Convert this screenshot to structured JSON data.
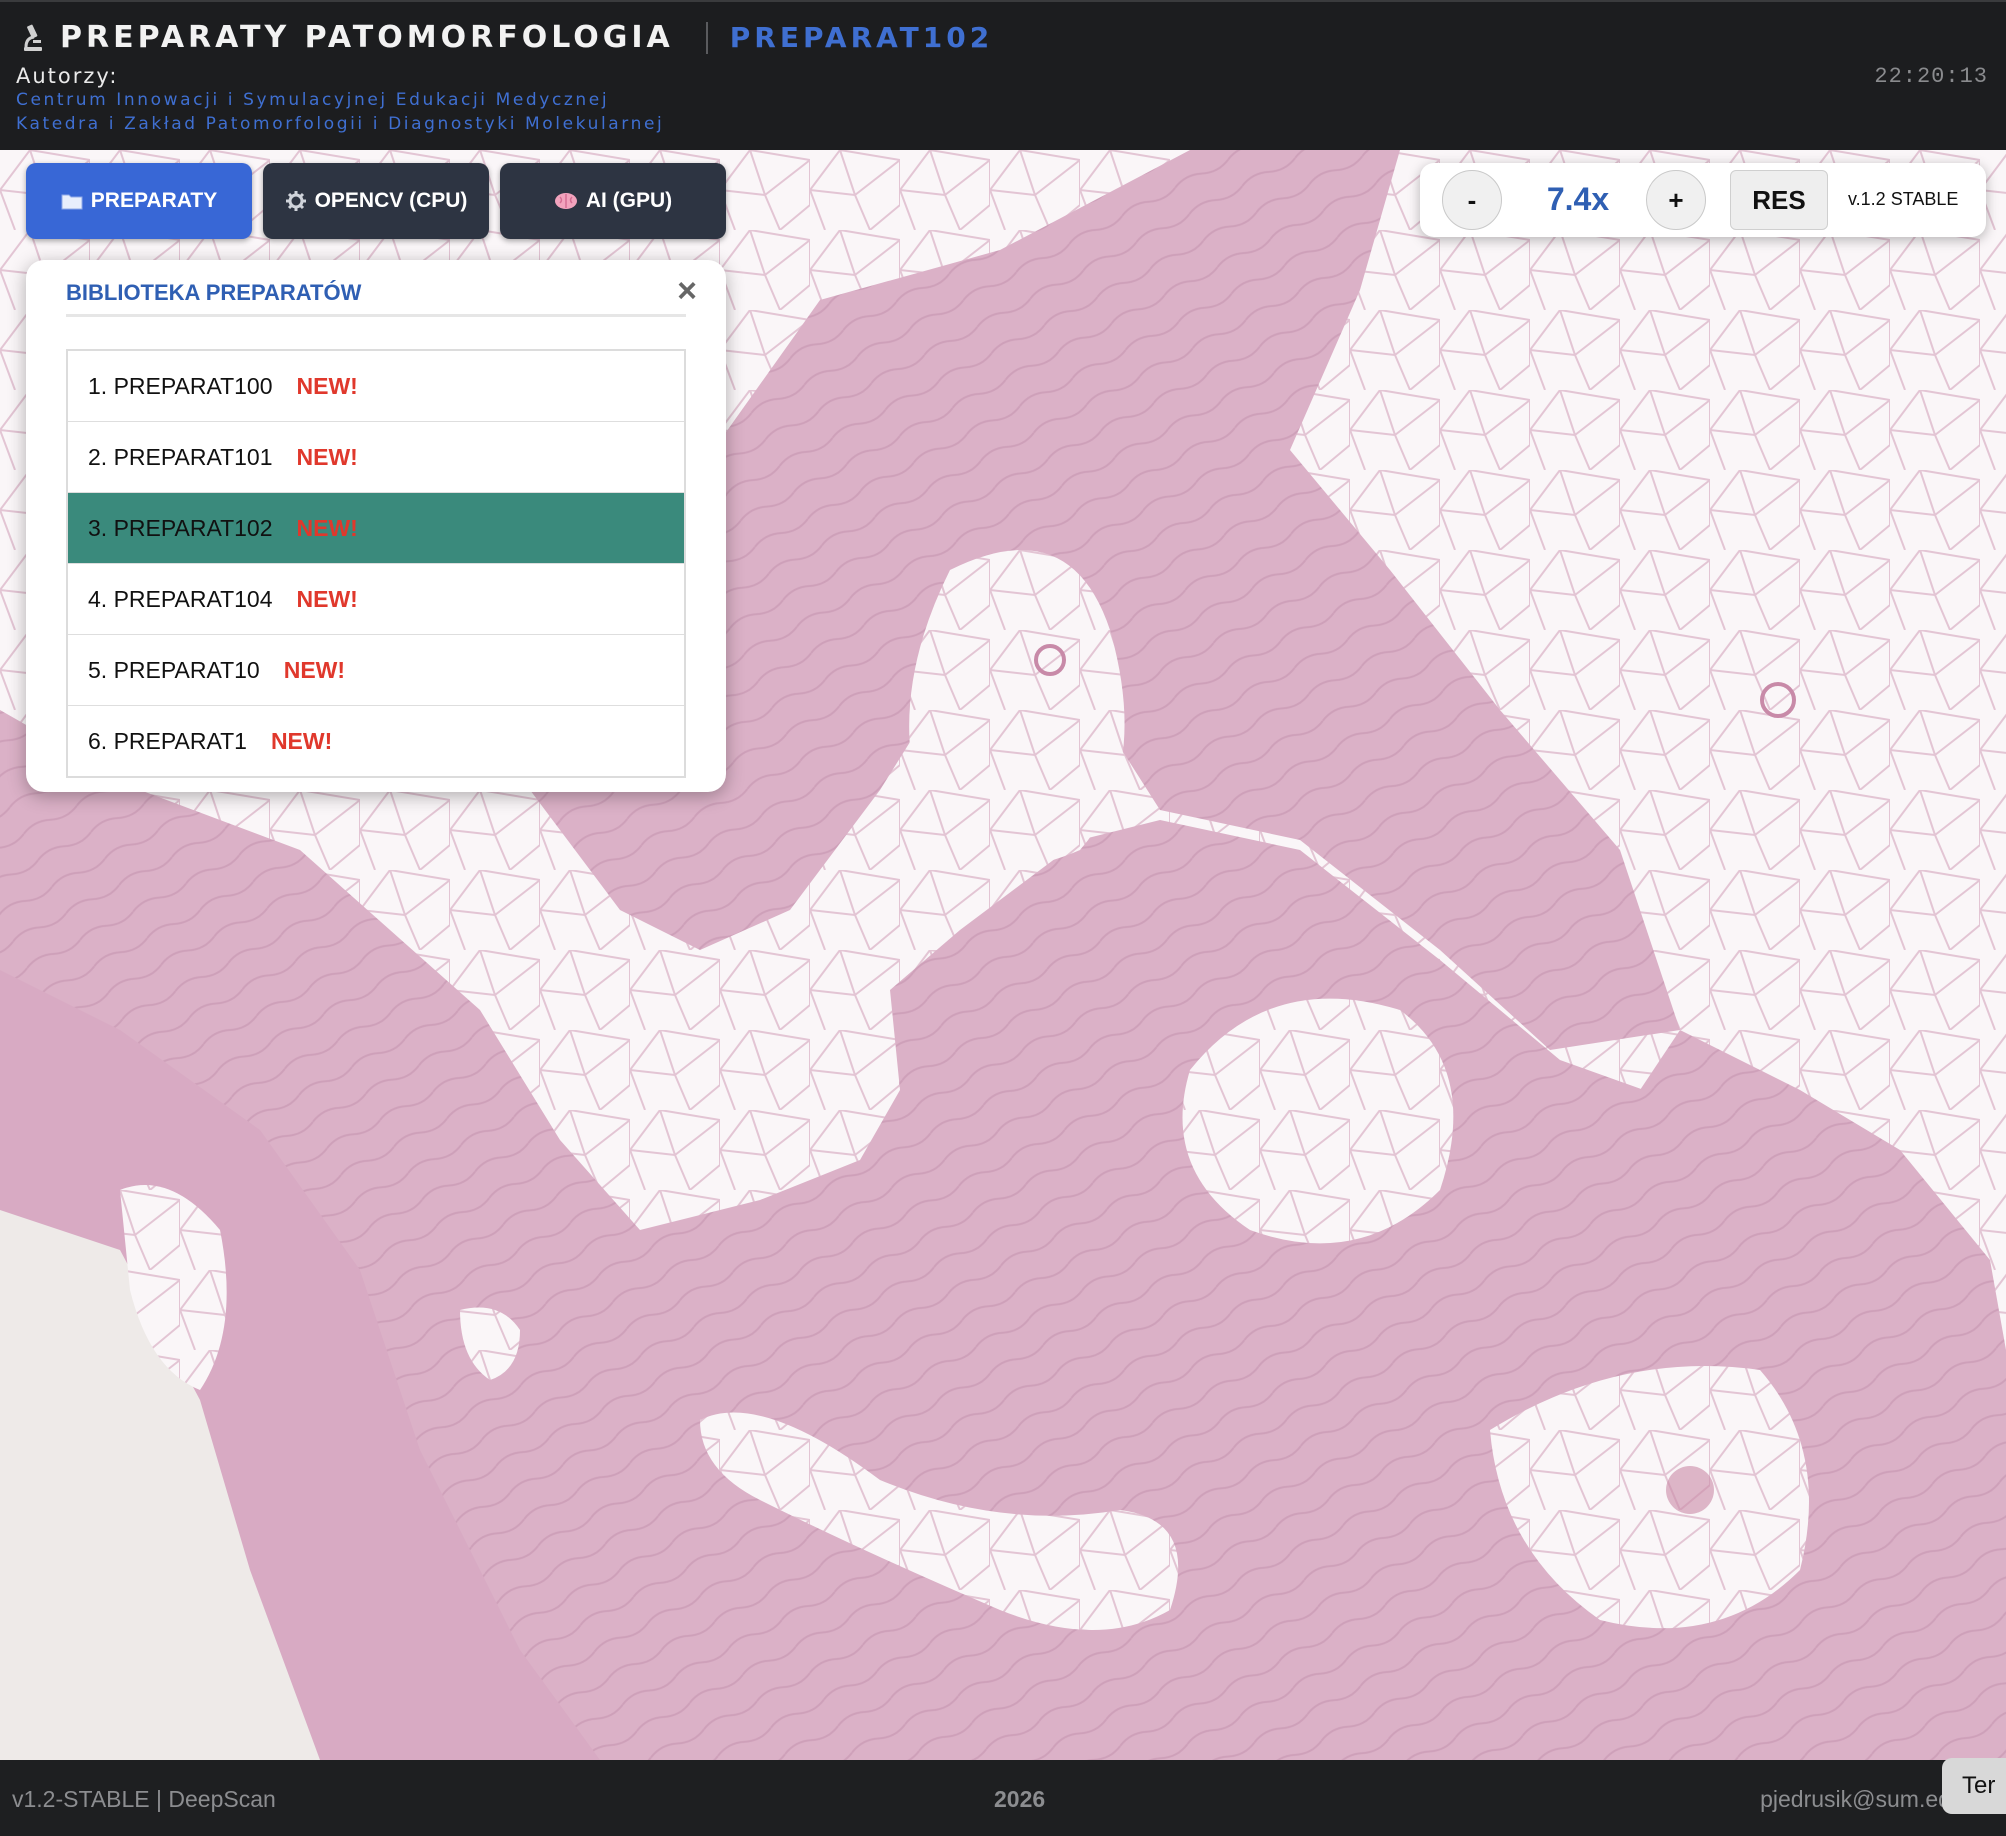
{
  "header": {
    "app_title": "PREPARATY PATOMORFOLOGIA",
    "current_slide": "PREPARAT102",
    "authors_label": "Autorzy:",
    "authors": [
      "Centrum Innowacji i Symulacyjnej Edukacji Medycznej",
      "Katedra i Zakład Patomorfologii i Diagnostyki Molekularnej"
    ],
    "clock": "22:20:13"
  },
  "toolbar": {
    "preparaty": {
      "icon": "folder-icon",
      "label": "PREPARATY",
      "color": "#3867d6"
    },
    "opencv": {
      "icon": "gear-icon",
      "label": "OPENCV (CPU)",
      "color": "#2d3442"
    },
    "ai": {
      "icon": "brain-icon",
      "label": "AI (GPU)",
      "color": "#2d3442"
    }
  },
  "zoom": {
    "minus_label": "-",
    "value": "7.4x",
    "plus_label": "+",
    "reset_label": "RES",
    "version": "v.1.2 STABLE"
  },
  "library": {
    "title": "BIBLIOTEKA PREPARATÓW",
    "close_icon": "close-icon",
    "selected_index": 2,
    "items": [
      {
        "label": "1. PREPARAT100",
        "badge": "NEW!"
      },
      {
        "label": "2. PREPARAT101",
        "badge": "NEW!"
      },
      {
        "label": "3. PREPARAT102",
        "badge": "NEW!"
      },
      {
        "label": "4. PREPARAT104",
        "badge": "NEW!"
      },
      {
        "label": "5. PREPARAT10",
        "badge": "NEW!"
      },
      {
        "label": "6. PREPARAT1",
        "badge": "NEW!"
      }
    ]
  },
  "footer": {
    "left": "v1.2-STABLE | DeepScan",
    "center": "2026",
    "right": "pjedrusik@sum.edu.pl",
    "theme_button": "Ter"
  },
  "colors": {
    "accent": "#3867d6",
    "selected_row": "#3a8a7c",
    "badge": "#e0382c",
    "tissue": "#dcaec8"
  }
}
